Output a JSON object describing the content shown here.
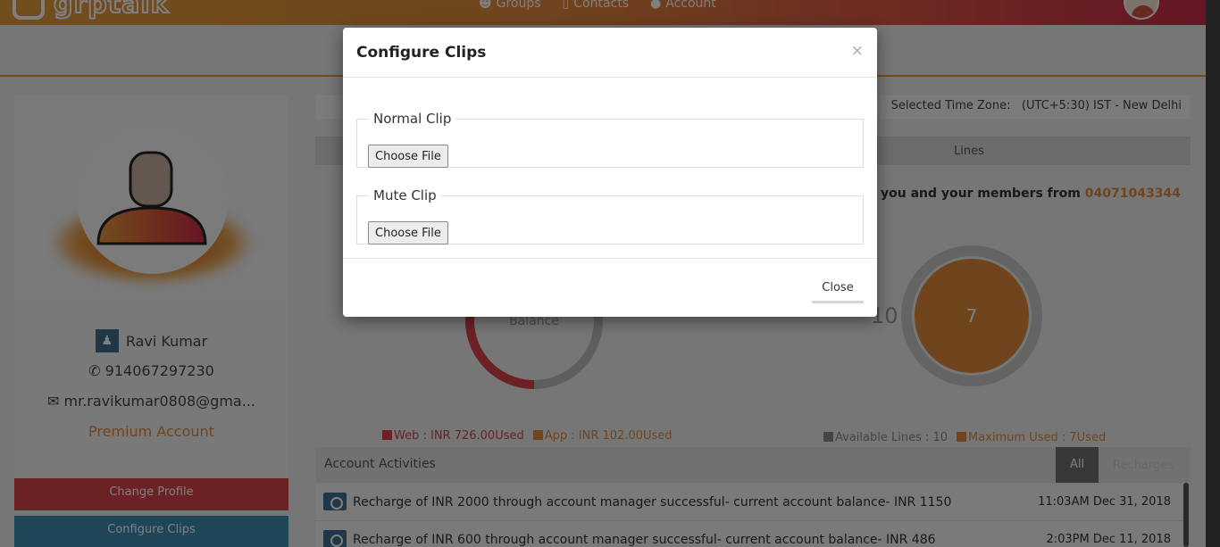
{
  "app": {
    "logo_text": "grptalk"
  },
  "nav": {
    "items": [
      {
        "icon": "groups-icon",
        "label": "Groups"
      },
      {
        "icon": "contacts-icon",
        "label": "Contacts"
      },
      {
        "icon": "account-icon",
        "label": "Account"
      }
    ]
  },
  "profile": {
    "name": "Ravi Kumar",
    "phone": "914067297230",
    "email": "mr.ravikumar0808@gma...",
    "plan": "Premium Account",
    "change_label": "Change Profile",
    "configure_label": "Configure Clips"
  },
  "timezone": {
    "label": "Selected Time Zone:",
    "value": "(UTC+5:30) IST - New Delhi"
  },
  "tabs": {
    "lines": "Lines"
  },
  "members": {
    "text": "you and your members from",
    "number": "04071043344"
  },
  "balance_chart": {
    "center_label": "Balance",
    "segments": [
      {
        "name": "Web",
        "value": 726.0,
        "color": "#d8424b"
      },
      {
        "name": "App",
        "value": 102.0,
        "color": "#e08a3c"
      },
      {
        "name": "remaining",
        "value": 322.0,
        "color": "#bdbdbd"
      }
    ],
    "legend": [
      {
        "text": "Web : INR 726.00Used",
        "color": "#d8424b"
      },
      {
        "text": "App : INR 102.00Used",
        "color": "#e08a3c"
      }
    ]
  },
  "lines_chart": {
    "available": "10",
    "used": "7",
    "legend": [
      {
        "text": "Available Lines : 10",
        "color": "#8a8a8a"
      },
      {
        "text": "Maximum Used : 7Used",
        "color": "#e08a3c"
      }
    ],
    "colors": {
      "ring": "#c8c8c8",
      "fill": "#e08a3c"
    }
  },
  "activities": {
    "title": "Account Activities",
    "tab_all": "All",
    "tab_recharges": "Recharges",
    "rows": [
      {
        "text": "Recharge of INR 2000 through account manager successful- current account balance- INR 1150",
        "time": "11:03AM Dec 31, 2018"
      },
      {
        "text": "Recharge of INR 600 through account manager successful- current account balance- INR 486",
        "time": "2:03PM Dec 11, 2018"
      }
    ]
  },
  "modal": {
    "title": "Configure Clips",
    "close_x": "×",
    "normal_clip_label": "Normal Clip",
    "mute_clip_label": "Mute Clip",
    "choose_file_label": "Choose File",
    "close_label": "Close"
  }
}
